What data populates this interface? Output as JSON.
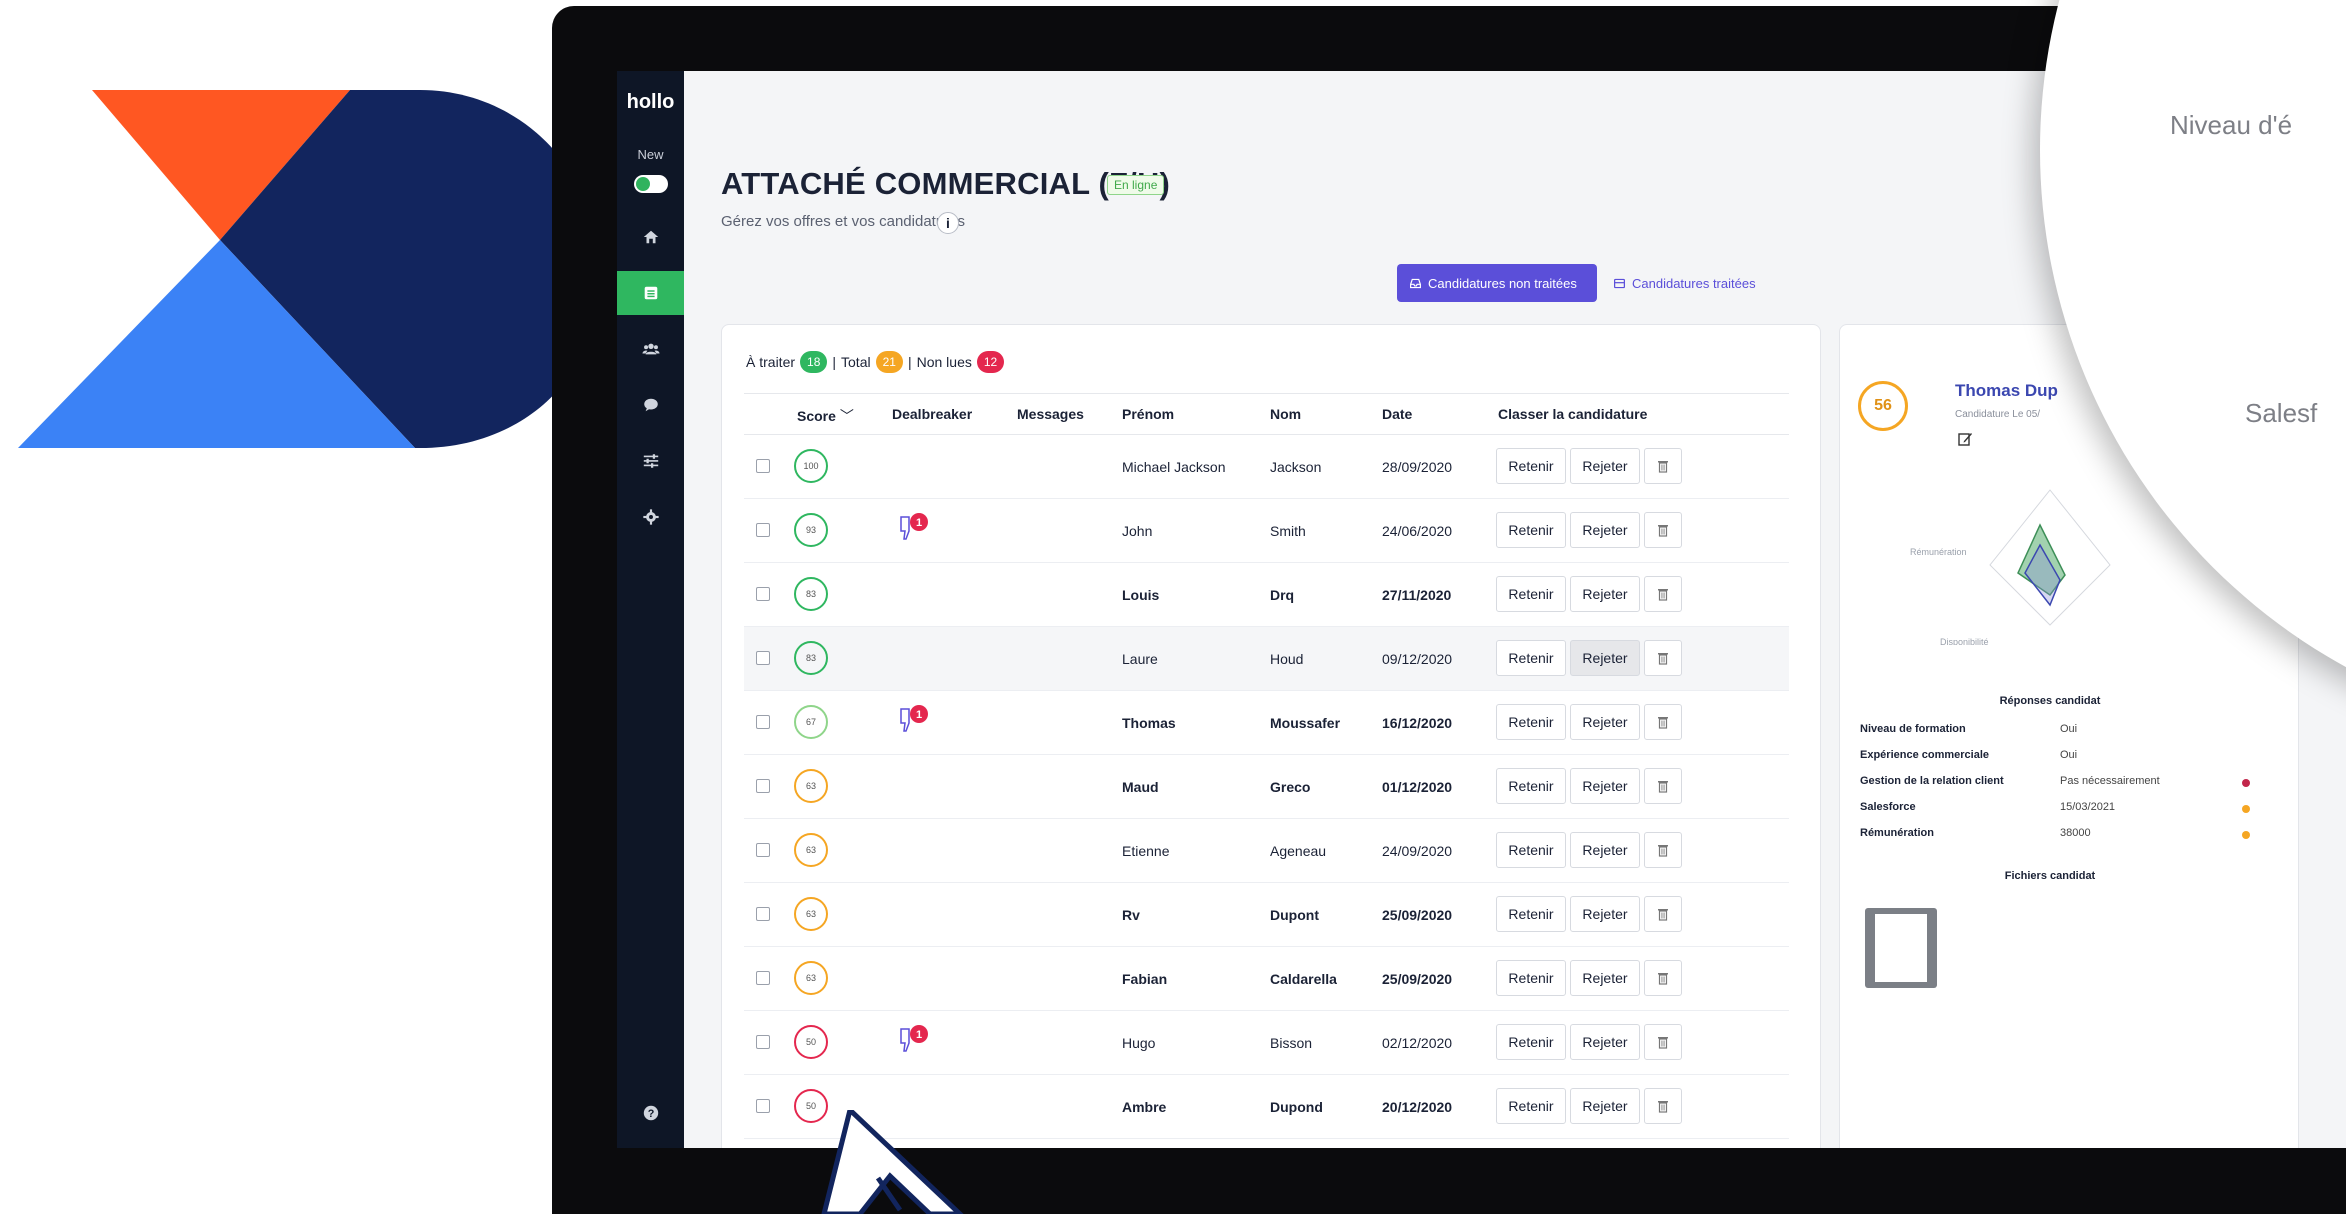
{
  "colors": {
    "brand_orange": "#ff5722",
    "brand_blue": "#3b82f6",
    "brand_navy": "#12255e",
    "accent_purple": "#5b4fd9",
    "green": "#2fb760",
    "orange": "#f5a623",
    "red": "#e4274e"
  },
  "sidebar": {
    "brand": "hollo",
    "new_label": "New",
    "items": [
      {
        "icon": "home-icon"
      },
      {
        "icon": "list-icon",
        "active": true
      },
      {
        "icon": "users-icon"
      },
      {
        "icon": "chat-icon"
      },
      {
        "icon": "sliders-icon"
      },
      {
        "icon": "gear-icon"
      }
    ],
    "help_icon": "help-icon"
  },
  "header": {
    "title": "ATTACHÉ COMMERCIAL (F/H)",
    "status": "En ligne",
    "subtitle": "Gérez vos offres et vos candidatures",
    "info": "i"
  },
  "tabs": [
    {
      "label": "Candidatures non traitées",
      "active": true
    },
    {
      "label": "Candidatures traitées",
      "active": false
    }
  ],
  "counts": {
    "a_traiter_label": "À traiter",
    "a_traiter": "18",
    "total_label": "Total",
    "total": "21",
    "non_lues_label": "Non lues",
    "non_lues": "12",
    "sep": "|"
  },
  "table": {
    "columns": {
      "score": "Score",
      "dealbreaker": "Dealbreaker",
      "messages": "Messages",
      "prenom": "Prénom",
      "nom": "Nom",
      "date": "Date",
      "classer": "Classer la candidature"
    },
    "actions": {
      "retenir": "Retenir",
      "rejeter": "Rejeter"
    },
    "rows": [
      {
        "score": "100",
        "score_color": "#2fb760",
        "prenom": "Michael Jackson",
        "nom": "Jackson",
        "date": "28/09/2020",
        "bold": false,
        "dealbreaker": ""
      },
      {
        "score": "93",
        "score_color": "#2fb760",
        "prenom": "John",
        "nom": "Smith",
        "date": "24/06/2020",
        "bold": false,
        "dealbreaker": "1"
      },
      {
        "score": "83",
        "score_color": "#2fb760",
        "prenom": "Louis",
        "nom": "Drq",
        "date": "27/11/2020",
        "bold": true,
        "dealbreaker": ""
      },
      {
        "score": "83",
        "score_color": "#2fb760",
        "prenom": "Laure",
        "nom": "Houd",
        "date": "09/12/2020",
        "bold": false,
        "dealbreaker": ""
      },
      {
        "score": "67",
        "score_color": "#8fd58a",
        "prenom": "Thomas",
        "nom": "Moussafer",
        "date": "16/12/2020",
        "bold": true,
        "dealbreaker": "1"
      },
      {
        "score": "63",
        "score_color": "#f5a623",
        "prenom": "Maud",
        "nom": "Greco",
        "date": "01/12/2020",
        "bold": true,
        "dealbreaker": ""
      },
      {
        "score": "63",
        "score_color": "#f5a623",
        "prenom": "Etienne",
        "nom": "Ageneau",
        "date": "24/09/2020",
        "bold": false,
        "dealbreaker": ""
      },
      {
        "score": "63",
        "score_color": "#f5a623",
        "prenom": "Rv",
        "nom": "Dupont",
        "date": "25/09/2020",
        "bold": true,
        "dealbreaker": ""
      },
      {
        "score": "63",
        "score_color": "#f5a623",
        "prenom": "Fabian",
        "nom": "Caldarella",
        "date": "25/09/2020",
        "bold": true,
        "dealbreaker": ""
      },
      {
        "score": "50",
        "score_color": "#e4274e",
        "prenom": "Hugo",
        "nom": "Bisson",
        "date": "02/12/2020",
        "bold": false,
        "dealbreaker": "1"
      },
      {
        "score": "50",
        "score_color": "#e4274e",
        "prenom": "Ambre",
        "nom": "Dupond",
        "date": "20/12/2020",
        "bold": true,
        "dealbreaker": ""
      }
    ]
  },
  "candidate": {
    "score": "56",
    "name": "Thomas Dup",
    "date_label": "Candidature Le 05/",
    "radar_labels": {
      "remuneration": "Rémunération",
      "disponibilite": "Disponibilité"
    },
    "responses_title": "Réponses candidat",
    "responses": [
      {
        "q": "Niveau de formation",
        "a": "Oui",
        "dot": ""
      },
      {
        "q": "Expérience commerciale",
        "a": "Oui",
        "dot": ""
      },
      {
        "q": "Gestion de la relation client",
        "a": "Pas nécessairement",
        "dot": "#c2264b"
      },
      {
        "q": "Salesforce",
        "a": "15/03/2021",
        "dot": "#f5a623"
      },
      {
        "q": "Rémunération",
        "a": "38000",
        "dot": "#f5a623"
      }
    ],
    "files_title": "Fichiers candidat"
  },
  "zoom": {
    "line1": "Niveau d'é",
    "line2": "Salesf"
  }
}
